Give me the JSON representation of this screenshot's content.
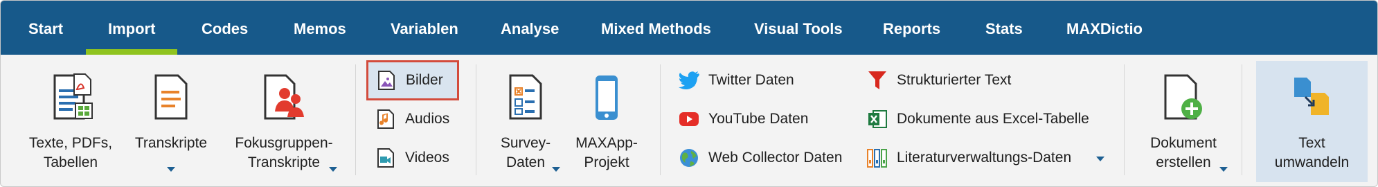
{
  "menubar": {
    "tabs": [
      {
        "label": "Start"
      },
      {
        "label": "Import",
        "active": true
      },
      {
        "label": "Codes"
      },
      {
        "label": "Memos"
      },
      {
        "label": "Variablen"
      },
      {
        "label": "Analyse"
      },
      {
        "label": "Mixed Methods"
      },
      {
        "label": "Visual Tools"
      },
      {
        "label": "Reports"
      },
      {
        "label": "Stats"
      },
      {
        "label": "MAXDictio"
      }
    ]
  },
  "ribbon": {
    "texte": {
      "line1": "Texte, PDFs,",
      "line2": "Tabellen",
      "icon": "document-pdf-table-icon"
    },
    "transkripte": {
      "line1": "Transkripte",
      "icon": "transcript-icon"
    },
    "fokus": {
      "line1": "Fokusgruppen-",
      "line2": "Transkripte",
      "icon": "focus-group-icon"
    },
    "bilder": {
      "label": "Bilder",
      "icon": "image-icon"
    },
    "audios": {
      "label": "Audios",
      "icon": "audio-icon"
    },
    "videos": {
      "label": "Videos",
      "icon": "video-icon"
    },
    "survey": {
      "line1": "Survey-",
      "line2": "Daten",
      "icon": "survey-icon"
    },
    "maxapp": {
      "line1": "MAXApp-",
      "line2": "Projekt",
      "icon": "mobile-phone-icon"
    },
    "twitter": {
      "label": "Twitter Daten",
      "icon": "twitter-icon"
    },
    "youtube": {
      "label": "YouTube Daten",
      "icon": "youtube-icon"
    },
    "webcollector": {
      "label": "Web Collector Daten",
      "icon": "globe-icon"
    },
    "strukturiert": {
      "label": "Strukturierter Text",
      "icon": "funnel-icon"
    },
    "excel": {
      "label": "Dokumente aus Excel-Tabelle",
      "icon": "excel-icon"
    },
    "literatur": {
      "label": "Literaturverwaltungs-Daten",
      "icon": "binders-icon"
    },
    "dokument": {
      "line1": "Dokument",
      "line2": "erstellen",
      "icon": "new-document-icon"
    },
    "textumwandeln": {
      "line1": "Text",
      "line2": "umwandeln",
      "icon": "convert-text-icon"
    }
  },
  "colors": {
    "menubar": "#17598a",
    "active_underline": "#8fc31f",
    "selection_border": "#d34b3c"
  }
}
